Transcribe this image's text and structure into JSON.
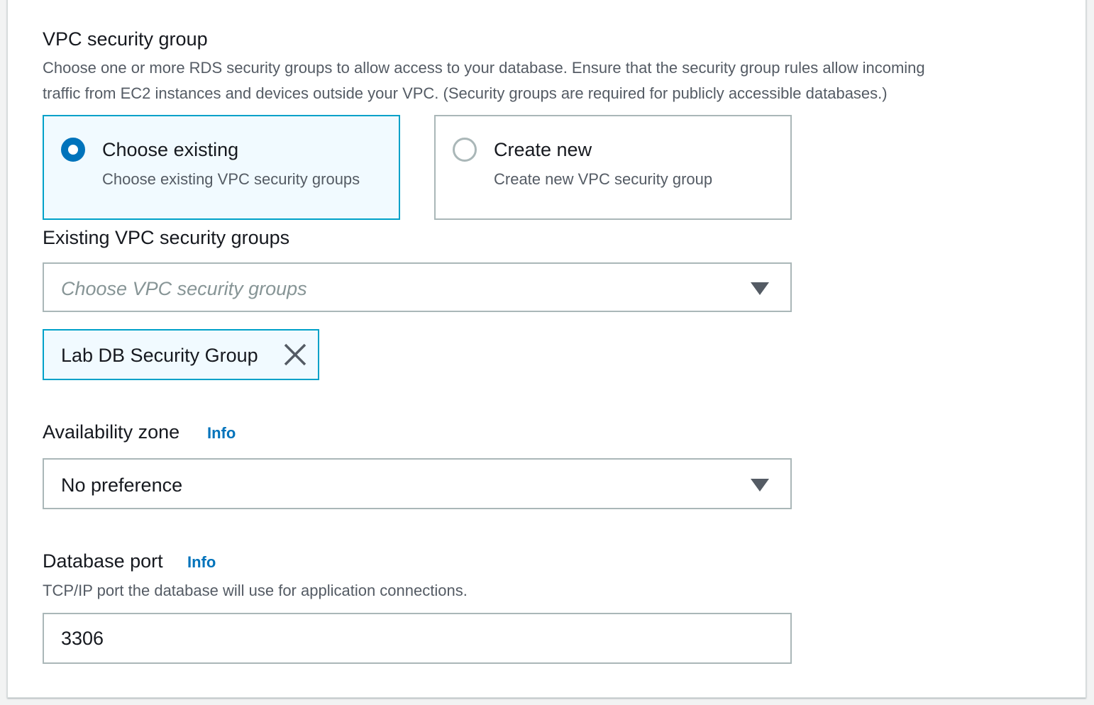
{
  "vpc_security_group": {
    "label": "VPC security group",
    "description_line1": "Choose one or more RDS security groups to allow access to your database. Ensure that the security group rules allow incoming",
    "description_line2": "traffic from EC2 instances and devices outside your VPC. (Security groups are required for publicly accessible databases.)",
    "options": [
      {
        "title": "Choose existing",
        "subtitle": "Choose existing VPC security groups",
        "selected": true
      },
      {
        "title": "Create new",
        "subtitle": "Create new VPC security group",
        "selected": false
      }
    ]
  },
  "existing_groups": {
    "label": "Existing VPC security groups",
    "placeholder": "Choose VPC security groups",
    "tokens": [
      "Lab DB Security Group"
    ]
  },
  "availability_zone": {
    "label": "Availability zone",
    "info": "Info",
    "value": "No preference"
  },
  "database_port": {
    "label": "Database port",
    "info": "Info",
    "description": "TCP/IP port the database will use for application connections.",
    "value": "3306"
  },
  "colors": {
    "accent": "#0073bb",
    "selected_border": "#00a1c9",
    "selected_bg": "#f1faff",
    "border": "#aab7b8",
    "text": "#16191f",
    "muted_text": "#545b64"
  },
  "icons": [
    "radio-selected",
    "radio-unselected",
    "caret-down-icon",
    "close-icon"
  ]
}
